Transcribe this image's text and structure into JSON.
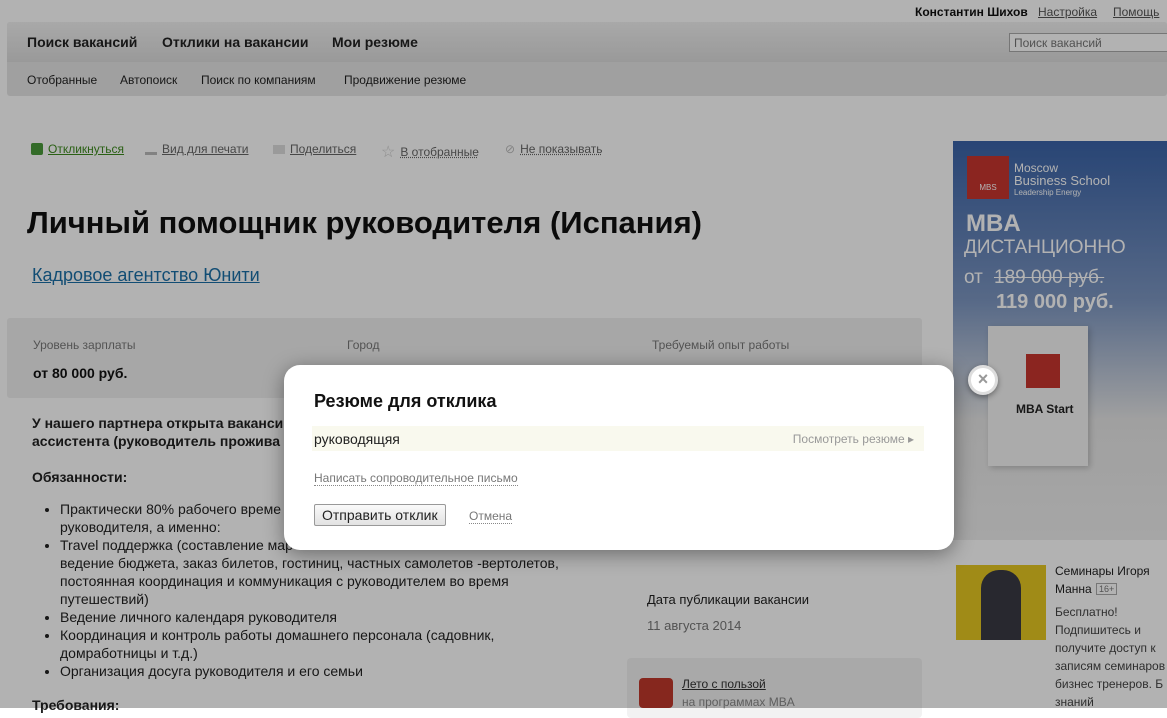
{
  "header": {
    "user": "Константин Шихов",
    "settings": "Настройка",
    "help": "Помощь",
    "search_placeholder": "Поиск вакансий"
  },
  "nav": {
    "main": [
      "Поиск вакансий",
      "Отклики на вакансии",
      "Мои резюме"
    ],
    "sub": [
      "Отобранные",
      "Автопоиск",
      "Поиск по компаниям",
      "Продвижение резюме"
    ]
  },
  "actions": [
    {
      "label": "Откликнуться",
      "icon": "respond-icon"
    },
    {
      "label": "Вид для печати",
      "icon": "print-icon"
    },
    {
      "label": "Поделиться",
      "icon": "share-icon"
    },
    {
      "label": "В отобранные",
      "icon": "star-icon"
    },
    {
      "label": "Не показывать",
      "icon": "hide-icon"
    }
  ],
  "vacancy": {
    "title": "Личный помощник руководителя (Испания)",
    "company": "Кадровое агентство Юнити",
    "salary_label": "Уровень зарплаты",
    "salary": "от 80 000 руб.",
    "city_label": "Город",
    "experience_label": "Требуемый опыт работы",
    "intro1": "У нашего партнера открыта ваканси",
    "intro2": "ассистента (руководитель прожива",
    "duties_title": "Обязанности:",
    "duties": [
      "Практически 80% рабочего време",
      "руководителя, а именно:",
      "Travel поддержка (составление мар",
      "ведение бюджета, заказ билетов, гостиниц, частных самолетов -вертолетов,",
      "постоянная координация и коммуникация с руководителем во время",
      "путешествий)",
      "Ведение личного календаря руководителя",
      "Координация и контроль работы домашнего персонала (садовник,",
      "домработницы и т.д.)",
      "Организация досуга руководителя и его семьи"
    ],
    "requirements_title": "Требования:",
    "date_label": "Дата публикации вакансии",
    "date": "11 августа 2014"
  },
  "promo": {
    "link": "Лето с пользой",
    "sub": "на программах MBA"
  },
  "ad": {
    "school1": "Moscow",
    "school2": "Business School",
    "tagline": "Leadership Energy",
    "mba": "MBA",
    "mode": "ДИСТАНЦИОННО",
    "from": "от",
    "old_price": "189 000 руб.",
    "price": "119 000 руб.",
    "box": "MBA Start"
  },
  "seminar": {
    "title1": "Семинары Игоря",
    "title2": "Манна",
    "age": "16+",
    "text": [
      "Бесплатно!",
      "Подпишитесь и",
      "получите доступ к",
      "записям семинаров",
      "бизнес тренеров. Б",
      "знаний"
    ]
  },
  "modal": {
    "title": "Резюме для отклика",
    "resume": "руководящяя",
    "view": "Посмотреть резюме ▸",
    "cover": "Написать сопроводительное письмо",
    "submit": "Отправить отклик",
    "cancel": "Отмена"
  }
}
